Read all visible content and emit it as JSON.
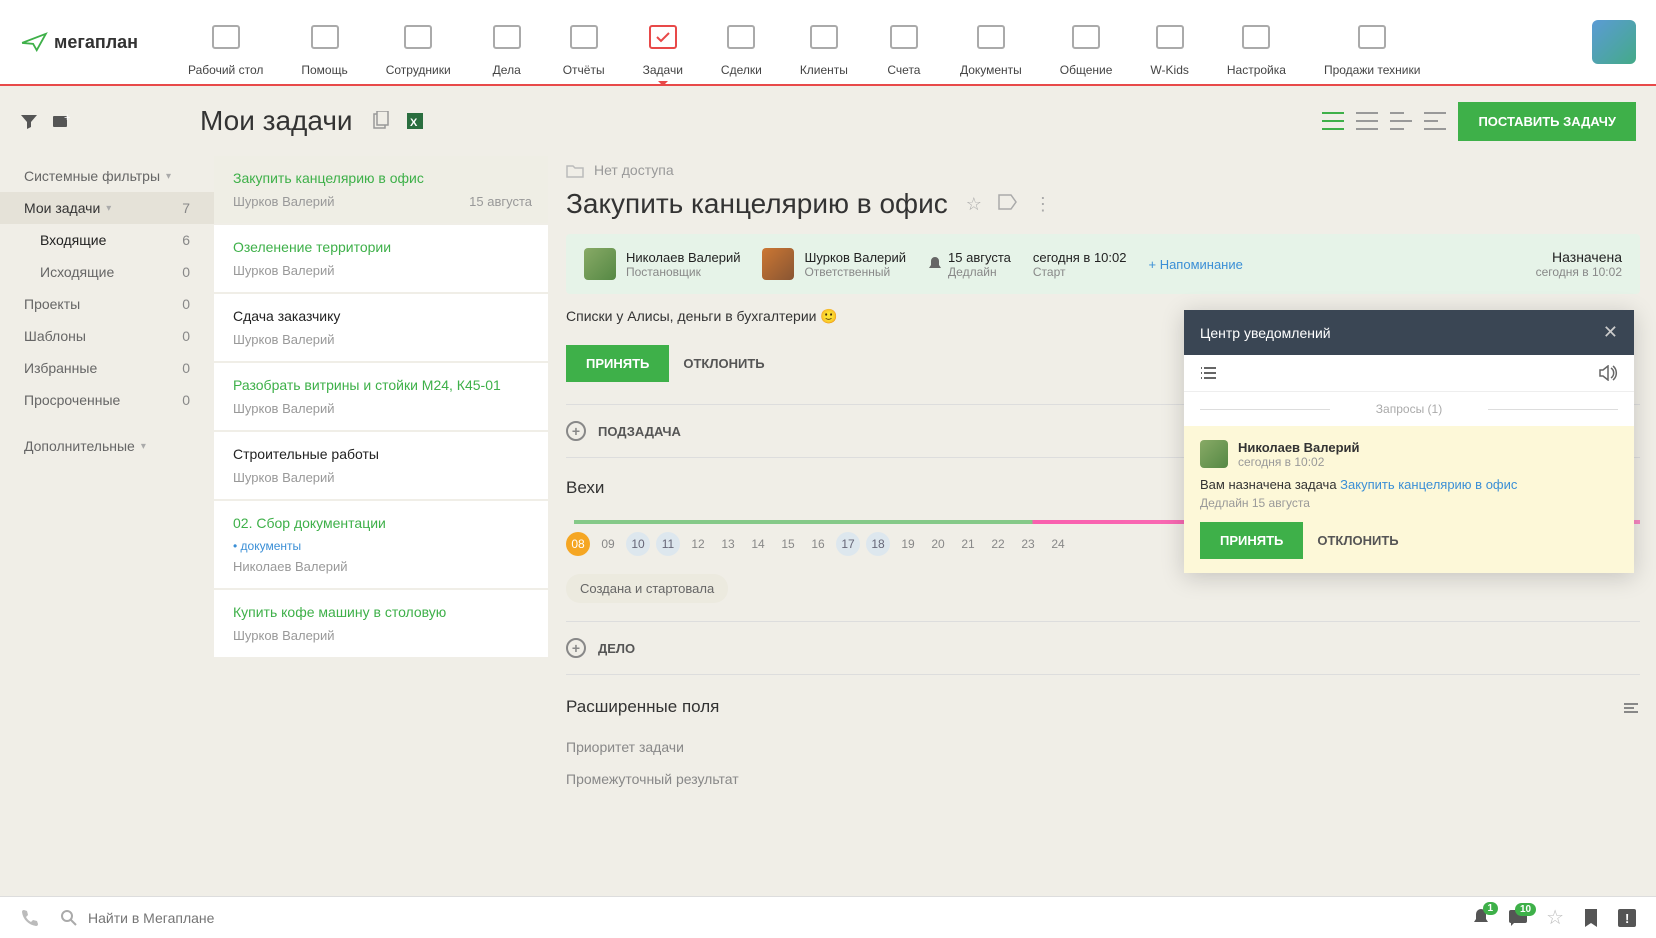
{
  "logo_text": "мегаплан",
  "nav": [
    {
      "label": "Рабочий стол"
    },
    {
      "label": "Помощь"
    },
    {
      "label": "Сотрудники"
    },
    {
      "label": "Дела"
    },
    {
      "label": "Отчёты"
    },
    {
      "label": "Задачи",
      "active": true
    },
    {
      "label": "Сделки"
    },
    {
      "label": "Клиенты"
    },
    {
      "label": "Счета"
    },
    {
      "label": "Документы"
    },
    {
      "label": "Общение"
    },
    {
      "label": "W-Kids"
    },
    {
      "label": "Настройка"
    },
    {
      "label": "Продажи техники"
    }
  ],
  "page_title": "Мои задачи",
  "primary_button": "ПОСТАВИТЬ ЗАДАЧУ",
  "sidebar": {
    "system_filters": "Системные фильтры",
    "items": [
      {
        "label": "Мои задачи",
        "count": "7",
        "active": true,
        "arrow": true
      },
      {
        "label": "Входящие",
        "count": "6",
        "sub": true,
        "bold": true
      },
      {
        "label": "Исходящие",
        "count": "0",
        "sub": true
      },
      {
        "label": "Проекты",
        "count": "0"
      },
      {
        "label": "Шаблоны",
        "count": "0"
      },
      {
        "label": "Избранные",
        "count": "0"
      },
      {
        "label": "Просроченные",
        "count": "0"
      }
    ],
    "additional": "Дополнительные"
  },
  "tasks": [
    {
      "title": "Закупить канцелярию в офис",
      "assignee": "Шурков Валерий",
      "date": "15 августа",
      "selected": true
    },
    {
      "title": "Озеленение территории",
      "assignee": "Шурков Валерий"
    },
    {
      "title": "Сдача заказчику",
      "assignee": "Шурков Валерий",
      "black": true
    },
    {
      "title": "Разобрать витрины и стойки М24, К45-01",
      "assignee": "Шурков Валерий"
    },
    {
      "title": "Строительные работы",
      "assignee": "Шурков Валерий",
      "black": true
    },
    {
      "title": "02. Сбор документации",
      "tag": "документы",
      "assignee": "Николаев Валерий"
    },
    {
      "title": "Купить кофе машину в столовую",
      "assignee": "Шурков Валерий"
    }
  ],
  "detail": {
    "breadcrumb": "Нет доступа",
    "title": "Закупить канцелярию в офис",
    "creator": {
      "name": "Николаев Валерий",
      "role": "Постановщик"
    },
    "responsible": {
      "name": "Шурков Валерий",
      "role": "Ответственный"
    },
    "deadline": {
      "value": "15 августа",
      "label": "Дедлайн"
    },
    "start": {
      "value": "сегодня в 10:02",
      "label": "Старт"
    },
    "reminder": "+ Напоминание",
    "status": {
      "value": "Назначена",
      "label": "сегодня в 10:02"
    },
    "description": "Списки у Алисы, деньги в бухгалтерии 🙂",
    "accept": "ПРИНЯТЬ",
    "decline": "ОТКЛОНИТЬ",
    "subtask": "ПОДЗАДАЧА",
    "milestones_title": "Вехи",
    "days": [
      "08",
      "09",
      "10",
      "11",
      "12",
      "13",
      "14",
      "15",
      "16",
      "17",
      "18",
      "19",
      "20",
      "21",
      "22",
      "23",
      "24"
    ],
    "milestone_chip": "Создана и стартовала",
    "activity": "ДЕЛО",
    "extended_title": "Расширенные поля",
    "priority": "Приоритет задачи",
    "interim": "Промежуточный результат"
  },
  "notif": {
    "title": "Центр уведомлений",
    "section": "Запросы (1)",
    "from": "Николаев Валерий",
    "time": "сегодня в 10:02",
    "msg_pre": "Вам назначена задача ",
    "msg_link": "Закупить канцелярию в офис",
    "deadline": "Дедлайн 15 августа",
    "accept": "ПРИНЯТЬ",
    "decline": "ОТКЛОНИТЬ"
  },
  "footer": {
    "search_placeholder": "Найти в Мегаплане",
    "bell_badge": "1",
    "chat_badge": "10"
  }
}
